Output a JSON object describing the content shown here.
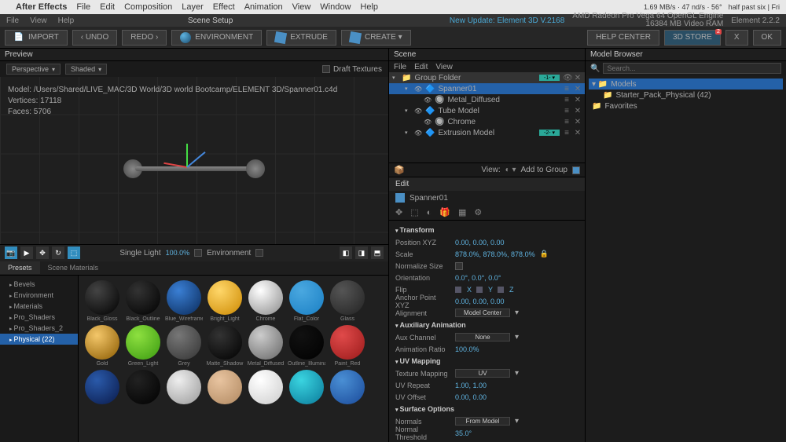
{
  "menubar": {
    "app": "After Effects",
    "items": [
      "File",
      "Edit",
      "Composition",
      "Layer",
      "Effect",
      "Animation",
      "View",
      "Window",
      "Help"
    ],
    "time": "half past six | Fri",
    "stats": "1.69 MB/s · 47 nd/s · 56°"
  },
  "subbar": {
    "items": [
      "File",
      "View",
      "Help"
    ],
    "title": "Scene Setup",
    "update": "New Update: Element 3D V.2168",
    "gpu1": "AMD Radeon Pro Vega 64 OpenGL Engine",
    "gpu2": "16384 MB Video RAM",
    "elem": "Element 2.2.2"
  },
  "toolbar": {
    "import": "IMPORT",
    "undo": "‹ UNDO",
    "redo": "REDO ›",
    "environment": "ENVIRONMENT",
    "extrude": "EXTRUDE",
    "create": "CREATE ▾",
    "help": "HELP CENTER",
    "store": "3D STORE",
    "storebadge": "2",
    "x": "X",
    "ok": "OK"
  },
  "preview": {
    "title": "Preview",
    "perspective": "Perspective",
    "shaded": "Shaded",
    "draft": "Draft Textures",
    "info_model": "Model: /Users/Shared/LIVE_MAC/3D World/3D world Bootcamp/ELEMENT 3D/Spanner01.c4d",
    "info_vertices": "Vertices: 17118",
    "info_faces": "Faces: 5706",
    "light": "Single Light",
    "light_pct": "100.0%",
    "env_label": "Environment"
  },
  "presets": {
    "tab1": "Presets",
    "tab2": "Scene Materials",
    "tree": [
      "Bevels",
      "Environment",
      "Materials",
      "Pro_Shaders",
      "Pro_Shaders_2",
      "Physical (22)"
    ],
    "selected": 5,
    "row1": [
      "Black_Gloss",
      "Black_Outline",
      "Blue_Wireframe",
      "Bright_Light",
      "Chrome",
      "Flat_Color",
      "Glass"
    ],
    "row2": [
      "Gold",
      "Green_Light",
      "Grey",
      "Matte_Shadow",
      "Metal_Diffused",
      "Outline_Illuminat...",
      "Paint_Red"
    ],
    "row3": [
      "",
      "",
      "",
      "",
      "",
      "",
      ""
    ]
  },
  "scene": {
    "title": "Scene",
    "subs": [
      "File",
      "Edit",
      "View"
    ],
    "groupfolder": "Group Folder",
    "items": [
      {
        "name": "Spanner01",
        "indent": 1,
        "sel": true
      },
      {
        "name": "Metal_Diffused",
        "indent": 2,
        "sel": false
      },
      {
        "name": "Tube Model",
        "indent": 1,
        "sel": false
      },
      {
        "name": "Chrome",
        "indent": 2,
        "sel": false
      },
      {
        "name": "Extrusion Model",
        "indent": 1,
        "sel": false,
        "tag": "2"
      }
    ],
    "view": "View:",
    "addgroup": "Add to Group"
  },
  "edit": {
    "title": "Edit",
    "obj": "Spanner01",
    "sections": {
      "transform": "Transform",
      "aux": "Auxiliary Animation",
      "uv": "UV Mapping",
      "surf": "Surface Options"
    },
    "props": {
      "pos_lbl": "Position XYZ",
      "pos_val": "0.00, 0.00, 0.00",
      "scale_lbl": "Scale",
      "scale_val": "878.0%, 878.0%, 878.0%",
      "norm_lbl": "Normalize Size",
      "orient_lbl": "Orientation",
      "orient_val": "0.0°, 0.0°, 0.0°",
      "flip_lbl": "Flip",
      "flip_x": "X",
      "flip_y": "Y",
      "flip_z": "Z",
      "anchor_lbl": "Anchor Point XYZ",
      "anchor_val": "0.00, 0.00, 0.00",
      "align_lbl": "Alignment",
      "align_val": "Model Center",
      "aux_lbl": "Aux Channel",
      "aux_val": "None",
      "animratio_lbl": "Animation Ratio",
      "animratio_val": "100.0%",
      "texmap_lbl": "Texture Mapping",
      "texmap_val": "UV",
      "uvrep_lbl": "UV Repeat",
      "uvrep_val": "1.00, 1.00",
      "uvoff_lbl": "UV Offset",
      "uvoff_val": "0.00, 0.00",
      "normals_lbl": "Normals",
      "normals_val": "From Model",
      "nthresh_lbl": "Normal Threshold",
      "nthresh_val": "35.0°"
    }
  },
  "browser": {
    "title": "Model Browser",
    "search": "Search...",
    "models": "Models",
    "starter": "Starter_Pack_Physical (42)",
    "fav": "Favorites"
  }
}
